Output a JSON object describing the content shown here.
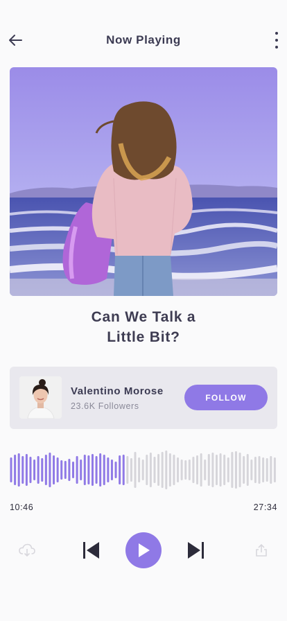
{
  "header": {
    "title": "Now Playing",
    "back_icon": "arrow-left-icon",
    "more_icon": "more-vertical-icon"
  },
  "song": {
    "title_line1": "Can We Talk a",
    "title_line2": "Little Bit?"
  },
  "artist": {
    "name": "Valentino Morose",
    "followers": "23.6K Followers",
    "follow_label": "FOLLOW"
  },
  "player": {
    "current_time": "10:46",
    "total_time": "27:34",
    "progress": 0.43,
    "controls": [
      "download-icon",
      "skip-previous-icon",
      "play-icon",
      "skip-next-icon",
      "share-icon"
    ]
  },
  "colors": {
    "accent": "#8f79e6",
    "wave_played": "#8f79e6",
    "wave_unplayed": "#d6d5da",
    "card_bg": "#e9e8ee",
    "text": "#3b3a52"
  }
}
